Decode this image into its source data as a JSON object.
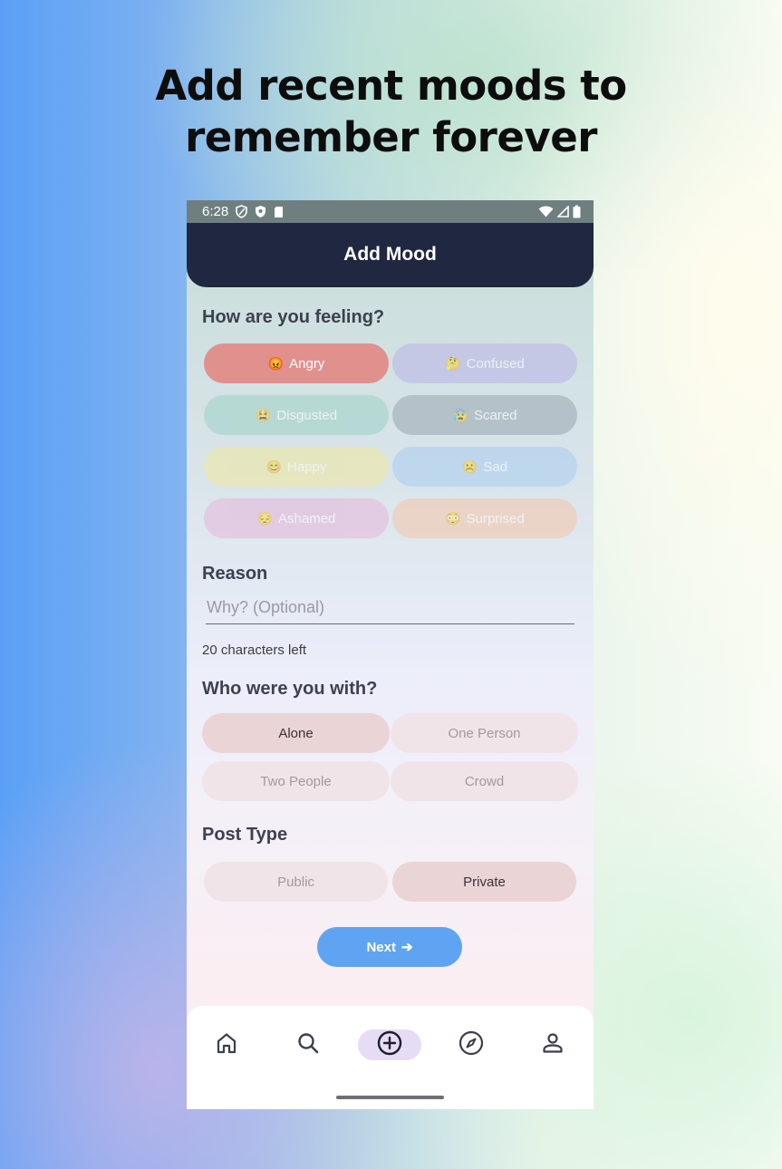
{
  "headline": {
    "line1": "Add recent moods to",
    "line2": "remember forever"
  },
  "status_bar": {
    "time": "6:28"
  },
  "app_bar": {
    "title": "Add Mood"
  },
  "feeling": {
    "title": "How are you feeling?",
    "moods": [
      {
        "label": "Angry",
        "emoji": "😡",
        "color": "#e0918e",
        "selected": true
      },
      {
        "label": "Confused",
        "emoji": "🤔",
        "color": "#b9b5e8",
        "selected": false
      },
      {
        "label": "Disgusted",
        "emoji": "😫",
        "color": "#9fd2c6",
        "selected": false
      },
      {
        "label": "Scared",
        "emoji": "😰",
        "color": "#9aa7b0",
        "selected": false
      },
      {
        "label": "Happy",
        "emoji": "😊",
        "color": "#f0e89c",
        "selected": false
      },
      {
        "label": "Sad",
        "emoji": "☹️",
        "color": "#a8cdef",
        "selected": false
      },
      {
        "label": "Ashamed",
        "emoji": "😔",
        "color": "#e6b6da",
        "selected": false
      },
      {
        "label": "Surprised",
        "emoji": "😳",
        "color": "#f5c5a9",
        "selected": false
      }
    ]
  },
  "reason": {
    "title": "Reason",
    "placeholder": "Why? (Optional)",
    "char_left": "20 characters left"
  },
  "company": {
    "title": "Who were you with?",
    "options": [
      {
        "label": "Alone",
        "selected": true
      },
      {
        "label": "One Person",
        "selected": false
      },
      {
        "label": "Two People",
        "selected": false
      },
      {
        "label": "Crowd",
        "selected": false
      }
    ]
  },
  "post_type": {
    "title": "Post Type",
    "options": [
      {
        "label": "Public",
        "selected": false
      },
      {
        "label": "Private",
        "selected": true
      }
    ]
  },
  "next_button": {
    "label": "Next",
    "arrow": "➔"
  },
  "bottom_nav": {
    "items": [
      {
        "icon": "home-icon"
      },
      {
        "icon": "search-icon"
      },
      {
        "icon": "add-circle-icon",
        "active": true
      },
      {
        "icon": "compass-icon"
      },
      {
        "icon": "profile-icon"
      }
    ]
  },
  "colors": {
    "app_bar": "#1f2840",
    "accent_button": "#5fa4f2",
    "nav_active": "#e6dcf6"
  }
}
